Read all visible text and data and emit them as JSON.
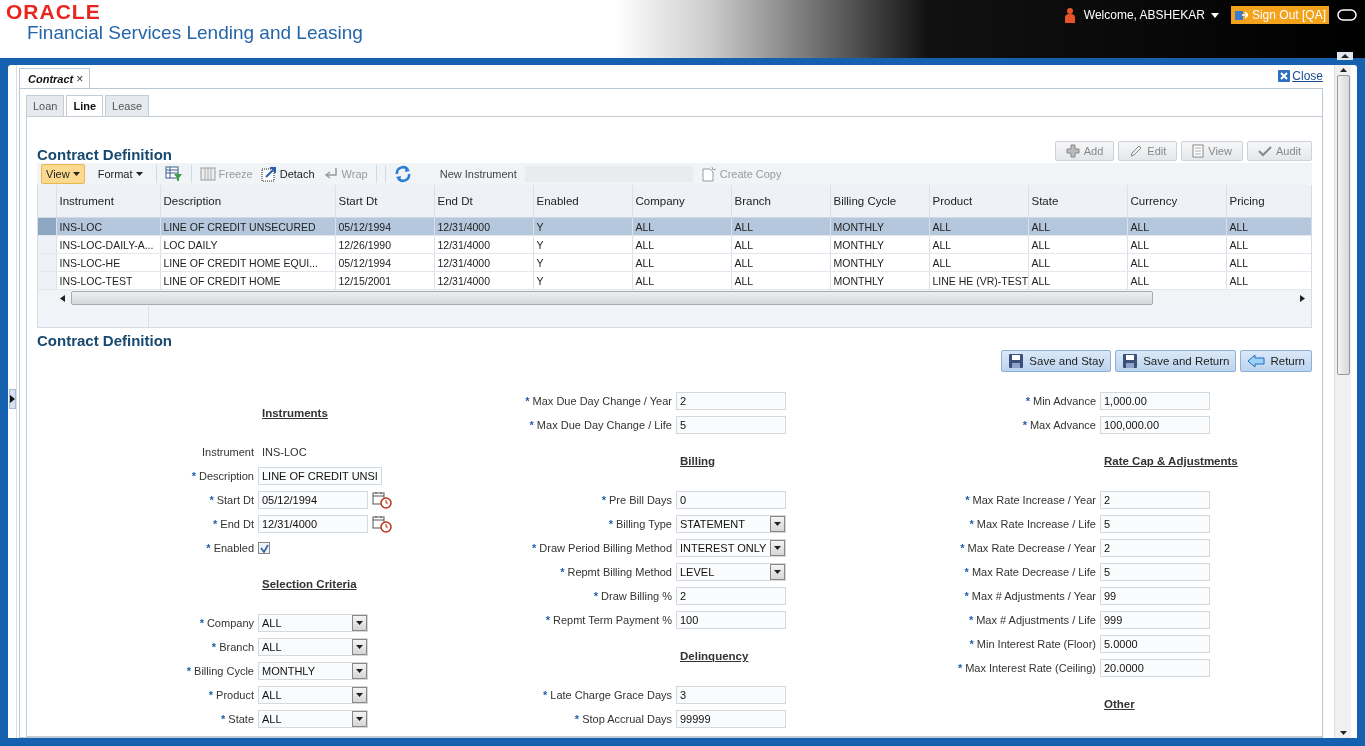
{
  "header": {
    "logo": "ORACLE",
    "product": "Financial Services Lending and Leasing",
    "user": "Welcome, ABSHEKAR",
    "sign_out": "Sign Out [QA]"
  },
  "doc_tabs": [
    {
      "label": "Contract",
      "close": "×",
      "selected": true
    }
  ],
  "close_link": "Close",
  "tabs": [
    {
      "label": "Loan",
      "selected": false
    },
    {
      "label": "Line",
      "selected": true
    },
    {
      "label": "Lease",
      "selected": false
    }
  ],
  "list_section": {
    "title": "Contract Definition",
    "actions": [
      {
        "label": "Add",
        "disabled": true
      },
      {
        "label": "Edit",
        "disabled": true
      },
      {
        "label": "View",
        "disabled": true
      },
      {
        "label": "Audit",
        "disabled": true
      }
    ],
    "toolbar": [
      {
        "kind": "menu",
        "label": "View",
        "selected": true
      },
      {
        "kind": "menu",
        "label": "Format",
        "selected": false
      },
      {
        "kind": "filter"
      },
      {
        "kind": "freeze",
        "label": "Freeze",
        "disabled": true
      },
      {
        "kind": "detach",
        "label": "Detach",
        "disabled": false
      },
      {
        "kind": "wrap",
        "label": "Wrap",
        "disabled": true
      },
      {
        "kind": "refresh"
      },
      {
        "kind": "field",
        "label": "New Instrument"
      },
      {
        "kind": "copy",
        "label": "Create Copy",
        "disabled": true
      }
    ],
    "table": {
      "columns": [
        "Instrument",
        "Description",
        "Start Dt",
        "End Dt",
        "Enabled",
        "Company",
        "Branch",
        "Billing Cycle",
        "Product",
        "State",
        "Currency",
        "Pricing"
      ],
      "rows": [
        {
          "selected": true,
          "cells": [
            "INS-LOC",
            "LINE OF CREDIT UNSECURED",
            "05/12/1994",
            "12/31/4000",
            "Y",
            "ALL",
            "ALL",
            "MONTHLY",
            "ALL",
            "ALL",
            "ALL",
            "ALL"
          ]
        },
        {
          "selected": false,
          "cells": [
            "INS-LOC-DAILY-A...",
            "LOC DAILY",
            "12/26/1990",
            "12/31/4000",
            "Y",
            "ALL",
            "ALL",
            "MONTHLY",
            "ALL",
            "ALL",
            "ALL",
            "ALL"
          ]
        },
        {
          "selected": false,
          "cells": [
            "INS-LOC-HE",
            "LINE OF CREDIT HOME EQUI...",
            "05/12/1994",
            "12/31/4000",
            "Y",
            "ALL",
            "ALL",
            "MONTHLY",
            "ALL",
            "ALL",
            "ALL",
            "ALL"
          ]
        },
        {
          "selected": false,
          "cells": [
            "INS-LOC-TEST",
            "LINE OF CREDIT HOME",
            "12/15/2001",
            "12/31/4000",
            "Y",
            "ALL",
            "ALL",
            "MONTHLY",
            "LINE HE (VR)-TEST",
            "ALL",
            "ALL",
            "ALL"
          ]
        }
      ]
    }
  },
  "detail_section": {
    "title": "Contract Definition",
    "required_mark": "*",
    "buttons": [
      {
        "kind": "save",
        "label": "Save and Stay"
      },
      {
        "kind": "save",
        "label": "Save and Return"
      },
      {
        "kind": "return",
        "label": "Return"
      }
    ],
    "columns": [
      [
        {
          "kind": "heading",
          "label": "Instruments"
        },
        {
          "kind": "static",
          "label": "Instrument",
          "value": "INS-LOC",
          "required": false
        },
        {
          "kind": "text",
          "label": "Description",
          "value": "LINE OF CREDIT UNSI",
          "required": true
        },
        {
          "kind": "date",
          "label": "Start Dt",
          "value": "05/12/1994",
          "required": true
        },
        {
          "kind": "date",
          "label": "End Dt",
          "value": "12/31/4000",
          "required": true
        },
        {
          "kind": "checkbox",
          "label": "Enabled",
          "checked": true,
          "required": true
        },
        {
          "kind": "heading",
          "label": "Selection Criteria"
        },
        {
          "kind": "select",
          "label": "Company",
          "value": "ALL",
          "required": true
        },
        {
          "kind": "select",
          "label": "Branch",
          "value": "ALL",
          "required": true
        },
        {
          "kind": "select",
          "label": "Billing Cycle",
          "value": "MONTHLY",
          "required": true
        },
        {
          "kind": "select",
          "label": "Product",
          "value": "ALL",
          "required": true
        },
        {
          "kind": "select",
          "label": "State",
          "value": "ALL",
          "required": true
        }
      ],
      [
        {
          "kind": "text",
          "label": "Max Due Day Change / Year",
          "value": "2",
          "required": true
        },
        {
          "kind": "text",
          "label": "Max Due Day Change / Life",
          "value": "5",
          "required": true
        },
        {
          "kind": "heading",
          "label": "Billing"
        },
        {
          "kind": "text",
          "label": "Pre Bill Days",
          "value": "0",
          "required": true
        },
        {
          "kind": "select",
          "label": "Billing Type",
          "value": "STATEMENT",
          "required": true
        },
        {
          "kind": "select",
          "label": "Draw Period Billing Method",
          "value": "INTEREST ONLY",
          "required": true
        },
        {
          "kind": "select",
          "label": "Repmt Billing Method",
          "value": "LEVEL",
          "required": true
        },
        {
          "kind": "text",
          "label": "Draw Billing %",
          "value": "2",
          "required": true
        },
        {
          "kind": "text",
          "label": "Repmt Term Payment %",
          "value": "100",
          "required": true
        },
        {
          "kind": "heading",
          "label": "Delinquency"
        },
        {
          "kind": "text",
          "label": "Late Charge Grace Days",
          "value": "3",
          "required": true
        },
        {
          "kind": "text",
          "label": "Stop Accrual Days",
          "value": "99999",
          "required": true
        }
      ],
      [
        {
          "kind": "text",
          "label": "Min Advance",
          "value": "1,000.00",
          "required": true
        },
        {
          "kind": "text",
          "label": "Max Advance",
          "value": "100,000.00",
          "required": true
        },
        {
          "kind": "heading",
          "label": "Rate Cap & Adjustments"
        },
        {
          "kind": "text",
          "label": "Max Rate Increase / Year",
          "value": "2",
          "required": true
        },
        {
          "kind": "text",
          "label": "Max Rate Increase / Life",
          "value": "5",
          "required": true
        },
        {
          "kind": "text",
          "label": "Max Rate Decrease / Year",
          "value": "2",
          "required": true
        },
        {
          "kind": "text",
          "label": "Max Rate Decrease / Life",
          "value": "5",
          "required": true
        },
        {
          "kind": "text",
          "label": "Max # Adjustments / Year",
          "value": "99",
          "required": true
        },
        {
          "kind": "text",
          "label": "Max # Adjustments / Life",
          "value": "999",
          "required": true
        },
        {
          "kind": "text",
          "label": "Min Interest Rate (Floor)",
          "value": "5.0000",
          "required": true
        },
        {
          "kind": "text",
          "label": "Max Interest Rate (Ceiling)",
          "value": "20.0000",
          "required": true
        },
        {
          "kind": "heading",
          "label": "Other"
        }
      ]
    ]
  }
}
